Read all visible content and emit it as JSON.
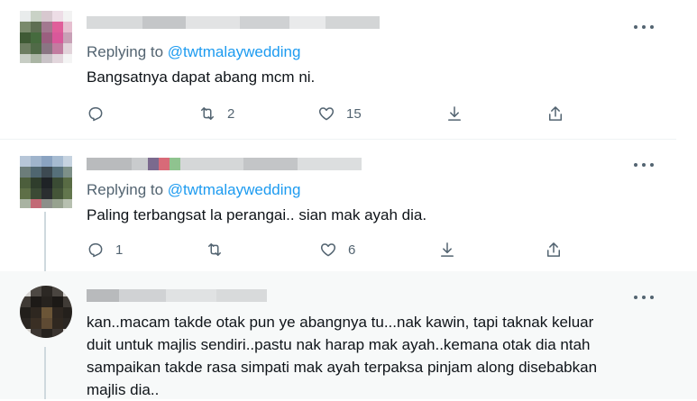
{
  "tweets": [
    {
      "replying_prefix": "Replying to ",
      "replying_handle": "@twtmalaywedding",
      "text": "Bangsatnya dapat abang mcm ni.",
      "reply_count": "",
      "retweet_count": "2",
      "like_count": "15"
    },
    {
      "replying_prefix": "Replying to ",
      "replying_handle": "@twtmalaywedding",
      "text": "Paling terbangsat la perangai.. sian mak ayah dia.",
      "reply_count": "1",
      "retweet_count": "",
      "like_count": "6"
    },
    {
      "text": "kan..macam takde otak pun ye abangnya tu...nak kawin, tapi taknak keluar\nduit untuk majlis sendiri..pastu nak harap mak ayah..kemana otak dia ntah\nsampaikan takde rasa simpati mak ayah terpaksa pinjam along disebabkan\nmajlis dia.."
    }
  ],
  "icons": {
    "reply": "reply-icon",
    "retweet": "retweet-icon",
    "like": "heart-icon",
    "download": "download-icon",
    "share": "share-icon",
    "more": "more-icon"
  },
  "colors": {
    "link": "#1d9bf0",
    "secondary_text": "#536471",
    "primary_text": "#0f1419"
  }
}
